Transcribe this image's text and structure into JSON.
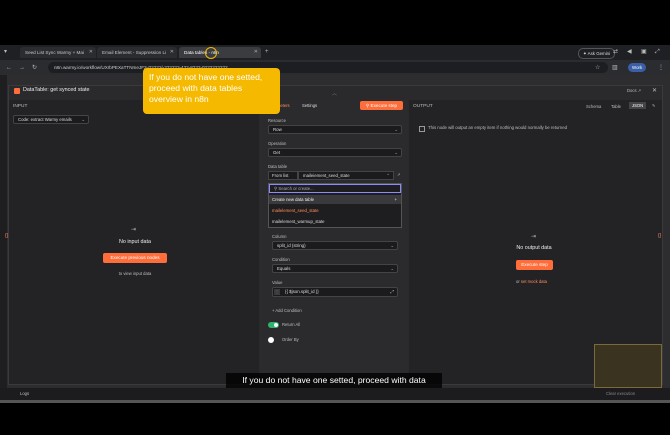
{
  "browser": {
    "tabs": [
      {
        "label": "Seed List Sync Warmy + Mai"
      },
      {
        "label": "Email Element - Suppression Li"
      },
      {
        "label": "Data tables - n8n"
      }
    ],
    "new_tab_glyph": "+",
    "url": "n8n.warmy.io/workflow/UXrbPEXaTTNmeJFzy?????/-??????-4??-8???-0?????????",
    "ask_gemini": "Ask Gemini",
    "profile": "Work"
  },
  "node": {
    "title": "DataTable: get synced state",
    "back_label": "Back to canvas",
    "docs_label": "Docs"
  },
  "input": {
    "title": "INPUT",
    "source_select": "Code: extract Warmy emails",
    "empty_title": "No input data",
    "execute_prev": "Execute previous nodes",
    "hint": "to view input data"
  },
  "params": {
    "tab_parameters": "Parameters",
    "tab_settings": "Settings",
    "execute_step": "Execute step",
    "resource_label": "Resource",
    "resource_value": "Row",
    "operation_label": "Operation",
    "operation_value": "Get",
    "table_label": "Data table",
    "table_mode": "From list",
    "table_value": "maileiement_seed_state",
    "search_placeholder": "Search or create...",
    "create_new": "Create new data table",
    "options": [
      "mailelement_seed_state",
      "mailelement_warmup_state"
    ],
    "column_label": "Column",
    "column_value": "split_id (string)",
    "condition_label": "Condition",
    "condition_value": "Equals",
    "value_label": "Value",
    "value_expr": "{{ $json.split_id }}",
    "add_condition": "Add Condition",
    "return_all": "Return All",
    "order_by": "Order By"
  },
  "output": {
    "title": "OUTPUT",
    "views": [
      "Schema",
      "Table",
      "JSON"
    ],
    "note": "This node will output an empty item if nothing would normally be returned",
    "empty_title": "No output data",
    "execute_step": "Execute step",
    "or_label": "or",
    "mock_link": "set mock data"
  },
  "status": {
    "logs": "Logs",
    "clear": "Clear execution"
  },
  "overlay": {
    "tooltip": "If you do not have one setted, proceed with data tables overview in n8n",
    "subtitle": "If you do not have one setted, proceed with data"
  },
  "colors": {
    "accent": "#ff6d3b",
    "tooltip": "#f5b900",
    "toggle_on": "#2fb56b"
  }
}
